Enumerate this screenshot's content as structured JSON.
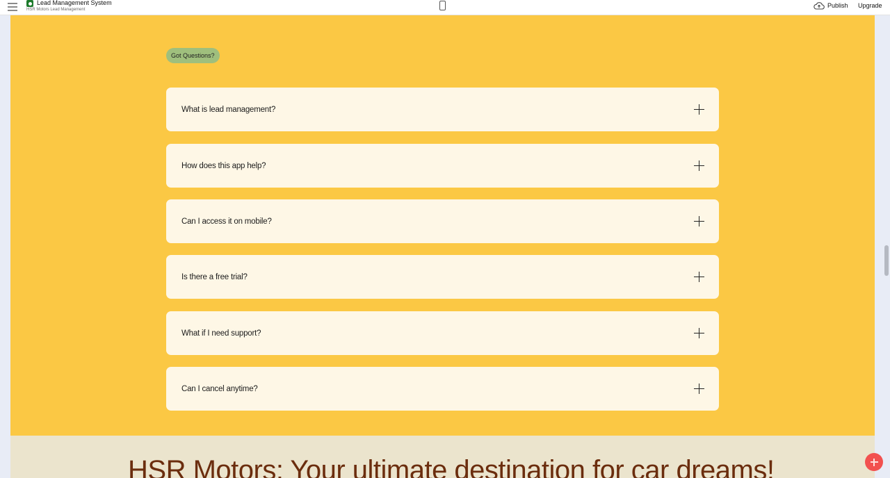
{
  "header": {
    "app_title": "Lead Management System",
    "app_subtitle": "HSR Motors Lead Management",
    "publish_label": "Publish",
    "upgrade_label": "Upgrade",
    "icons": [
      "menu-icon",
      "app-logo-icon",
      "mobile-device-icon",
      "cloud-upload-icon"
    ]
  },
  "faq": {
    "badge": "Got Questions?",
    "items": [
      {
        "question": "What is lead management?"
      },
      {
        "question": "How does this app help?"
      },
      {
        "question": "Can I access it on mobile?"
      },
      {
        "question": "Is there a free trial?"
      },
      {
        "question": "What if I need support?"
      },
      {
        "question": "Can I cancel anytime?"
      }
    ]
  },
  "hero": {
    "title": "HSR Motors: Your ultimate destination for car dreams!"
  },
  "colors": {
    "faq_background": "#fbc844",
    "badge_background": "#9fbf7d",
    "card_background": "#fef7e6",
    "hero_background": "#ebe4cd",
    "hero_title": "#6b2d0e",
    "fab": "#f2514f"
  }
}
